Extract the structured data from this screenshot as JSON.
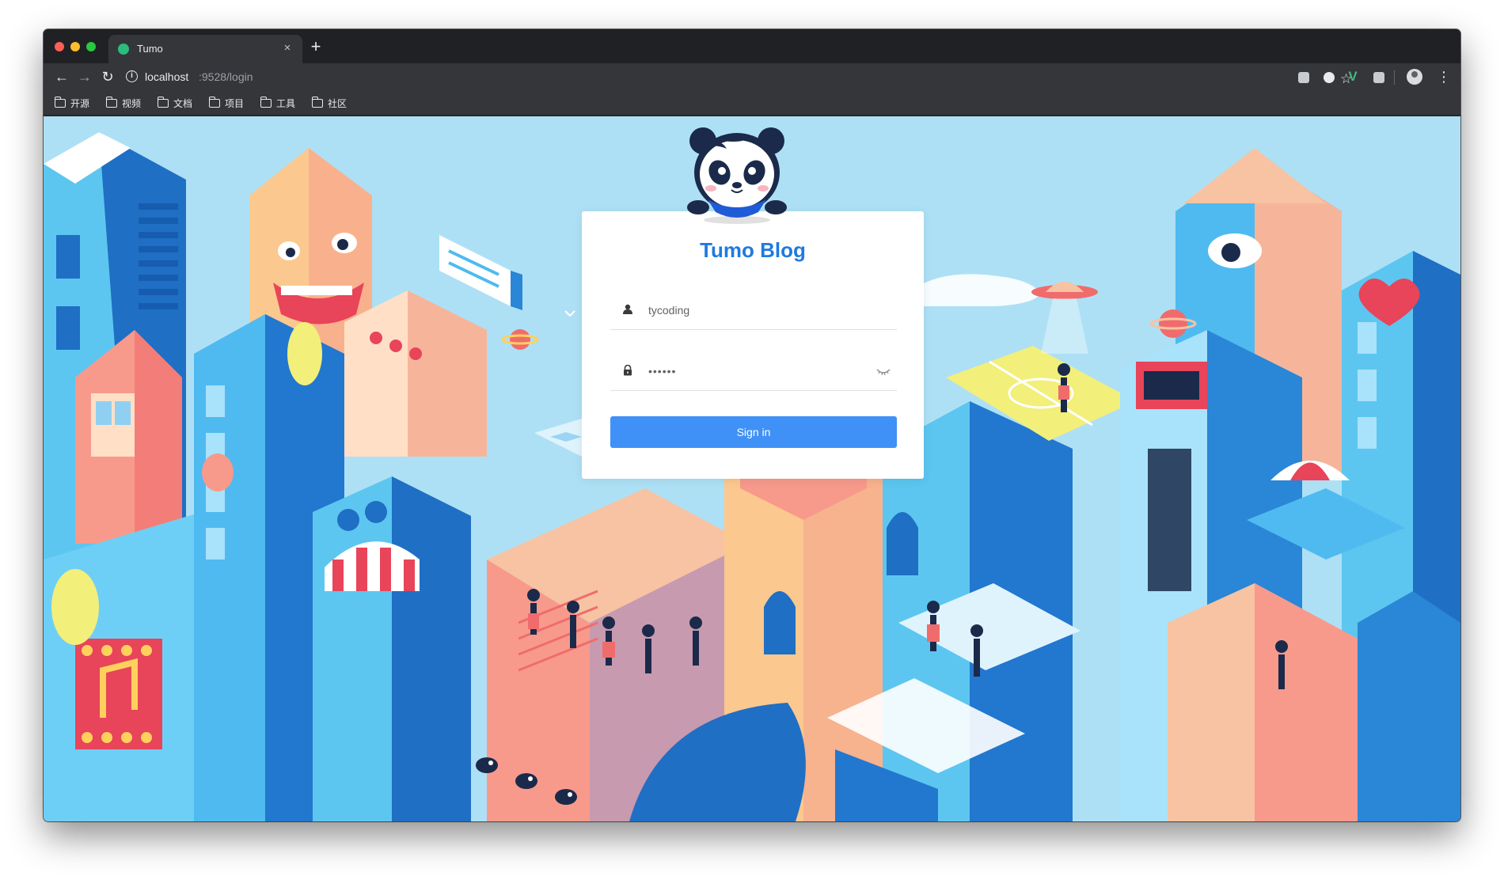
{
  "browser": {
    "tab_title": "Tumo",
    "tab_close": "×",
    "new_tab": "+",
    "url_host": "localhost",
    "url_path": ":9528/login",
    "back": "←",
    "forward": "→",
    "reload": "↻",
    "star": "☆",
    "menu": "⋮",
    "info": "i",
    "extension_v": "V",
    "bookmarks": [
      "开源",
      "视频",
      "文档",
      "项目",
      "工具",
      "社区"
    ]
  },
  "login": {
    "title": "Tumo Blog",
    "username": "tycoding",
    "password": "••••••",
    "submit_label": "Sign in"
  },
  "colors": {
    "accent": "#4091f7",
    "title": "#1f7ae0",
    "sky": "#aee0f5"
  },
  "icons": {
    "user": "user-icon",
    "lock": "lock-icon",
    "eye": "eye-closed-icon"
  }
}
